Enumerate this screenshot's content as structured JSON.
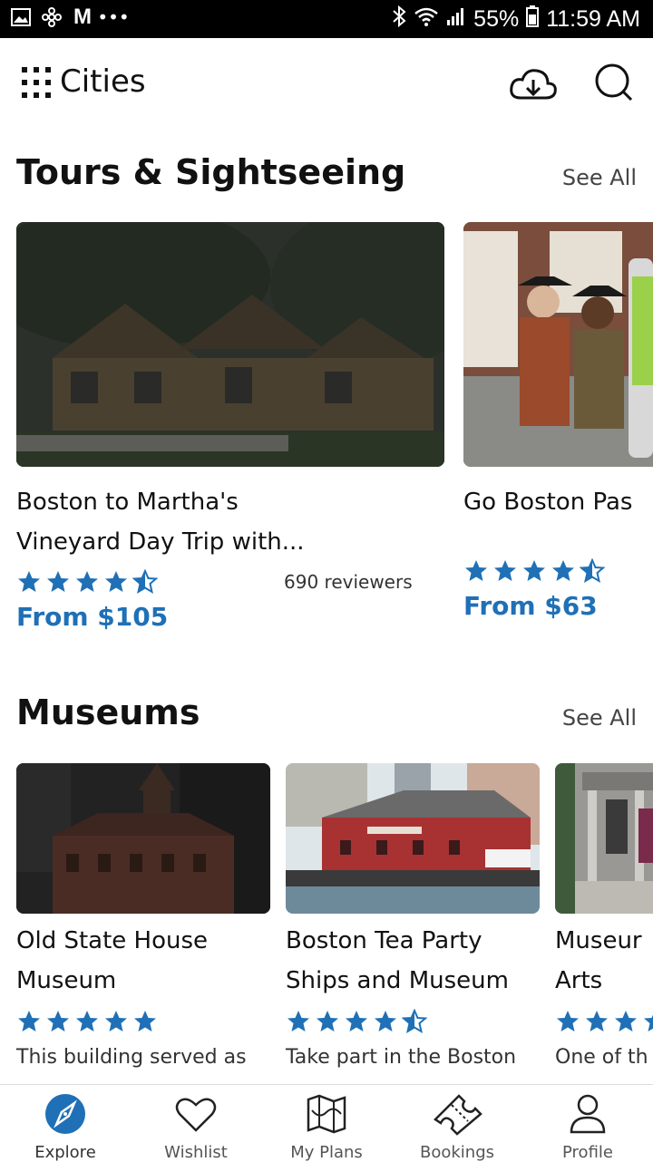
{
  "status_bar": {
    "left_icons": [
      "image-icon",
      "fan-icon",
      "gmail-icon",
      "more-icon"
    ],
    "battery_percent": "55%",
    "time": "11:59 AM"
  },
  "header": {
    "title": "Cities"
  },
  "tours": {
    "title": "Tours & Sightseeing",
    "see_all": "See All",
    "cards": [
      {
        "title_line1": "Boston to Martha's",
        "title_line2": "Vineyard Day Trip with...",
        "rating": 4.5,
        "reviewers": "690 reviewers",
        "price": "From $105"
      },
      {
        "title_line1": "Go Boston Pas",
        "rating": 4.5,
        "price": "From $63"
      }
    ]
  },
  "museums": {
    "title": "Museums",
    "see_all": "See All",
    "cards": [
      {
        "title_line1": "Old State House",
        "title_line2": "Museum",
        "rating": 5,
        "desc": "This building served as"
      },
      {
        "title_line1": "Boston Tea Party",
        "title_line2": "Ships and Museum",
        "rating": 4.5,
        "desc": "Take part in the Boston"
      },
      {
        "title_line1": "Museur",
        "title_line2": "Arts",
        "rating": 5,
        "desc": "One of th"
      }
    ]
  },
  "tabs": [
    {
      "label": "Explore",
      "icon": "compass-icon"
    },
    {
      "label": "Wishlist",
      "icon": "heart-icon"
    },
    {
      "label": "My Plans",
      "icon": "map-icon"
    },
    {
      "label": "Bookings",
      "icon": "ticket-icon"
    },
    {
      "label": "Profile",
      "icon": "user-icon"
    }
  ],
  "colors": {
    "accent": "#1f70b6",
    "star": "#1f70b6"
  }
}
